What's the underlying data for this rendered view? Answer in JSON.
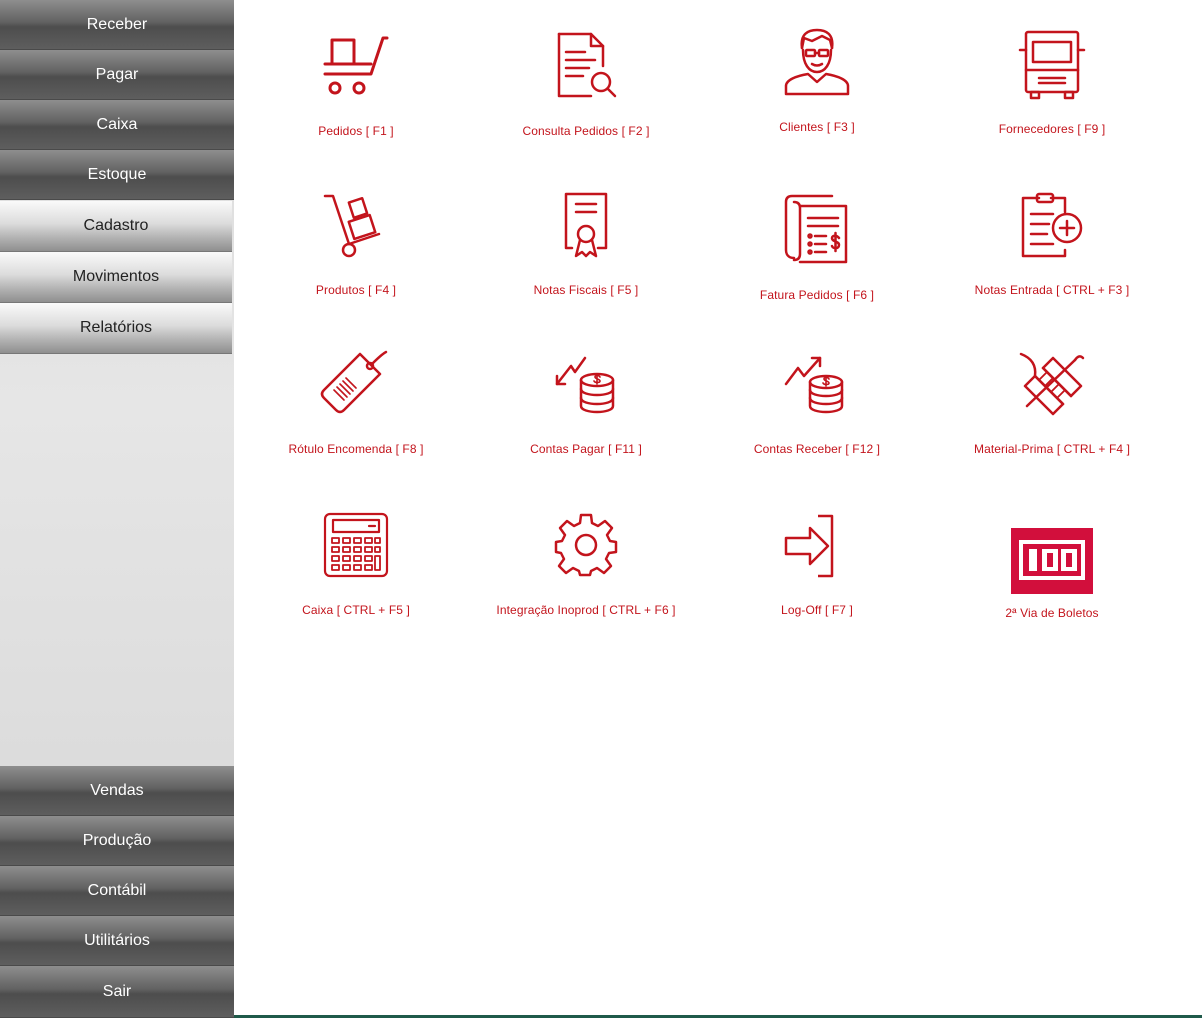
{
  "sidebar": {
    "top": [
      {
        "label": "Receber"
      },
      {
        "label": "Pagar"
      },
      {
        "label": "Caixa"
      },
      {
        "label": "Estoque"
      },
      {
        "label": "Cadastro"
      },
      {
        "label": "Movimentos"
      },
      {
        "label": "Relatórios"
      }
    ],
    "bottom": [
      {
        "label": "Vendas"
      },
      {
        "label": "Produção"
      },
      {
        "label": "Contábil"
      },
      {
        "label": "Utilitários"
      },
      {
        "label": "Sair"
      }
    ]
  },
  "tiles": [
    {
      "label": "Pedidos  [ F1 ]",
      "icon": "cart-icon"
    },
    {
      "label": "Consulta Pedidos  [ F2 ]",
      "icon": "document-search-icon"
    },
    {
      "label": "Clientes  [ F3 ]",
      "icon": "customer-icon"
    },
    {
      "label": "Fornecedores [ F9 ]",
      "icon": "truck-icon"
    },
    {
      "label": "Produtos  [ F4 ]",
      "icon": "hand-truck-icon"
    },
    {
      "label": "Notas Fiscais  [ F5 ]",
      "icon": "certificate-icon"
    },
    {
      "label": "Fatura Pedidos  [ F6 ]",
      "icon": "invoice-icon"
    },
    {
      "label": "Notas Entrada [ CTRL + F3 ]",
      "icon": "clipboard-add-icon"
    },
    {
      "label": "Rótulo Encomenda  [ F8 ]",
      "icon": "barcode-tag-icon"
    },
    {
      "label": "Contas Pagar [ F11 ]",
      "icon": "coins-down-icon"
    },
    {
      "label": "Contas Receber [ F12 ]",
      "icon": "coins-up-icon"
    },
    {
      "label": "Material-Prima [ CTRL + F4 ]",
      "icon": "thread-spool-icon"
    },
    {
      "label": "Caixa [ CTRL + F5 ]",
      "icon": "calculator-icon"
    },
    {
      "label": "Integração Inoprod [ CTRL + F6 ]",
      "icon": "gear-icon"
    },
    {
      "label": "Log-Off  [ F7 ]",
      "icon": "logout-icon"
    },
    {
      "label": "2ª Via de Boletos",
      "icon": "boleto-icon"
    }
  ],
  "colors": {
    "accent": "#c3141c",
    "sidebar_dark": "#5e5e5e",
    "sidebar_light": "#dcdcdc"
  }
}
